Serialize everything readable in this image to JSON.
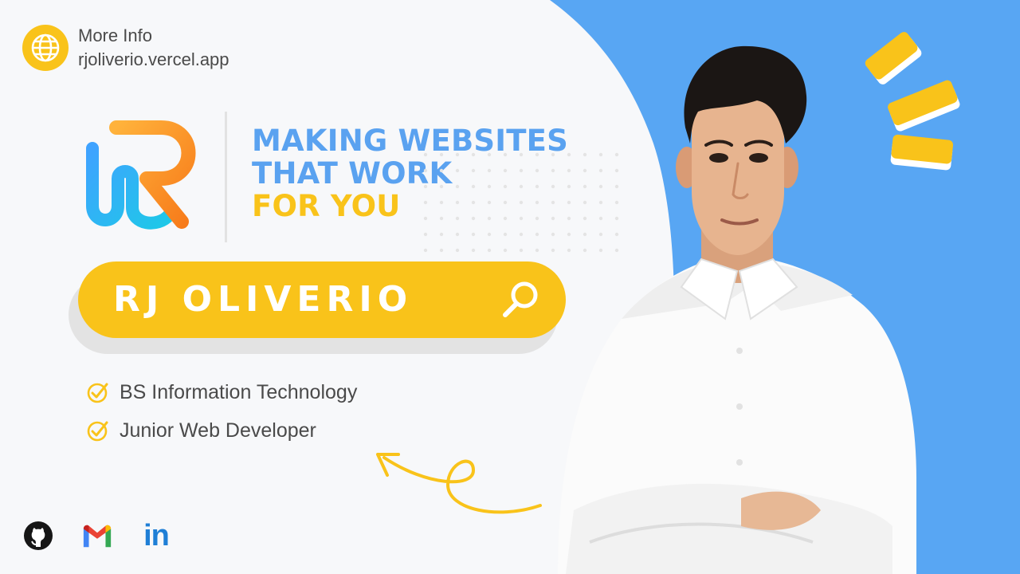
{
  "info": {
    "title": "More Info",
    "url": "rjoliverio.vercel.app",
    "icon": "globe-icon"
  },
  "headline": {
    "line1": "MAKING WEBSITES",
    "line2": "THAT WORK",
    "line3": "FOR YOU"
  },
  "search": {
    "name": "RJ OLIVERIO",
    "icon": "search-icon"
  },
  "qualifications": [
    {
      "label": "BS Information Technology",
      "icon": "check-icon"
    },
    {
      "label": "Junior Web Developer",
      "icon": "check-icon"
    }
  ],
  "socials": [
    {
      "name": "github-icon"
    },
    {
      "name": "gmail-icon"
    },
    {
      "name": "linkedin-icon",
      "text": "in"
    }
  ],
  "colors": {
    "blue": "#5aa2f0",
    "yellow": "#f9c31a",
    "background": "#f7f8fa",
    "text": "#4a4a4a"
  }
}
